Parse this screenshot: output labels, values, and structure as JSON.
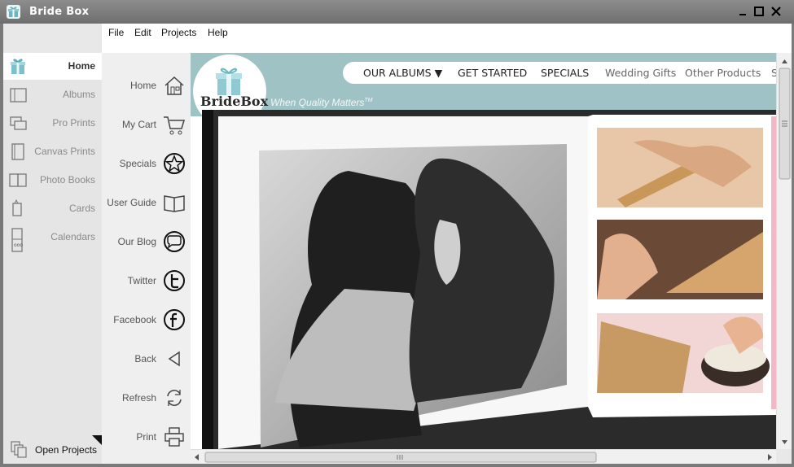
{
  "window": {
    "title": "Bride Box"
  },
  "menu": {
    "items": [
      "File",
      "Edit",
      "Projects",
      "Help"
    ]
  },
  "sidebar": {
    "items": [
      {
        "label": "Home",
        "icon": "gift-icon",
        "active": true
      },
      {
        "label": "Albums",
        "icon": "album-icon"
      },
      {
        "label": "Pro Prints",
        "icon": "prints-icon"
      },
      {
        "label": "Canvas Prints",
        "icon": "canvas-icon"
      },
      {
        "label": "Photo Books",
        "icon": "photobook-icon"
      },
      {
        "label": "Cards",
        "icon": "card-icon"
      },
      {
        "label": "Calendars",
        "icon": "calendar-icon"
      }
    ],
    "open_projects": "Open Projects"
  },
  "nav": {
    "items": [
      {
        "label": "Home",
        "icon": "house-icon"
      },
      {
        "label": "My Cart",
        "icon": "cart-icon"
      },
      {
        "label": "Specials",
        "icon": "star-icon"
      },
      {
        "label": "User Guide",
        "icon": "book-icon"
      },
      {
        "label": "Our Blog",
        "icon": "chat-icon"
      },
      {
        "label": "Twitter",
        "icon": "twitter-icon"
      },
      {
        "label": "Facebook",
        "icon": "facebook-icon"
      },
      {
        "label": "Back",
        "icon": "back-icon"
      },
      {
        "label": "Refresh",
        "icon": "refresh-icon"
      },
      {
        "label": "Print",
        "icon": "printer-icon"
      }
    ]
  },
  "web": {
    "logo": "BrideBox",
    "tagline": "When Quality Matters",
    "tagline_mark": "TM",
    "nav": [
      "OUR ALBUMS ▼",
      "GET STARTED",
      "SPECIALS",
      "Wedding Gifts",
      "Other Products",
      "S"
    ]
  },
  "colors": {
    "header": "#9fc3c5",
    "titlebar": "#7d7d7d"
  }
}
